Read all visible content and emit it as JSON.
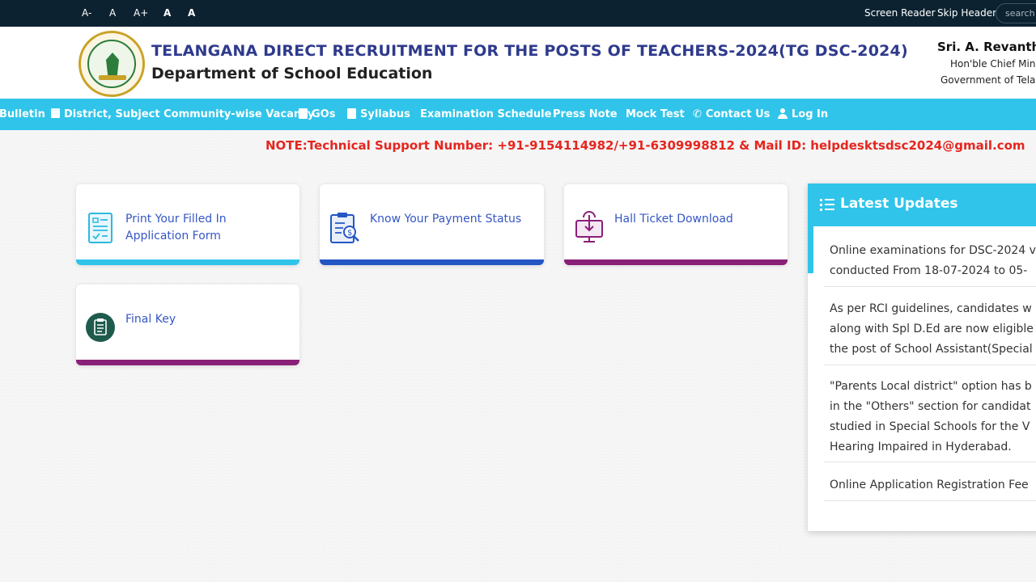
{
  "topbar": {
    "font_sizes": [
      "A-",
      "A",
      "A+",
      "A",
      "A"
    ],
    "screen_reader": "Screen Reader",
    "skip_header": "Skip Header",
    "search_placeholder": "search"
  },
  "header": {
    "title": "TELANGANA DIRECT RECRUITMENT FOR THE POSTS OF TEACHERS-2024(TG DSC-2024)",
    "subtitle": "Department of School Education",
    "cm_name": "Sri. A. Revanth R",
    "cm_role": "Hon'ble Chief Min",
    "cm_gov": "Government of Tela"
  },
  "nav": {
    "items": [
      {
        "label": "Bulletin",
        "icon": "none"
      },
      {
        "label": "District, Subject Community-wise Vacancy",
        "icon": "calendar-icon"
      },
      {
        "label": "GOs",
        "icon": "book-icon"
      },
      {
        "label": "Syllabus",
        "icon": "book-icon"
      },
      {
        "label": "Examination Schedule",
        "icon": "none"
      },
      {
        "label": "Press Note",
        "icon": "none"
      },
      {
        "label": "Mock Test",
        "icon": "none"
      },
      {
        "label": "Contact Us",
        "icon": "phone-icon"
      },
      {
        "label": "Log In",
        "icon": "user-icon"
      }
    ]
  },
  "note": "NOTE:Technical Support Number: +91-9154114982/+91-6309998812 & Mail ID: helpdesktsdsc2024@gmail.com",
  "cards": [
    {
      "line1": "Print Your Filled In",
      "line2": "Application Form",
      "icon": "form-icon",
      "bar_color": "#30c4ea"
    },
    {
      "line1": "Know Your Payment Status",
      "line2": "",
      "icon": "payment-status-icon",
      "bar_color": "#2456c4"
    },
    {
      "line1": "Hall Ticket Download",
      "line2": "",
      "icon": "download-icon",
      "bar_color": "#8a1f78"
    },
    {
      "line1": "Final Key",
      "line2": "",
      "icon": "clipboard-icon",
      "bar_color": "#8a1f78"
    }
  ],
  "updates": {
    "title": "Latest Updates",
    "items": [
      [
        "Online examinations for DSC-2024 v",
        "conducted From 18-07-2024 to 05-"
      ],
      [
        "As per RCI guidelines, candidates w",
        "along with Spl D.Ed are now eligible",
        "the post of School Assistant(Special"
      ],
      [
        "\"Parents Local district\" option has b",
        "in the \"Others\" section for candidat",
        "studied in Special Schools for the V",
        "Hearing Impaired in Hyderabad."
      ],
      [
        "Online Application Registration Fee"
      ]
    ]
  },
  "colors": {
    "topbar": "#0c2230",
    "nav": "#30c4ea",
    "note": "#e5261f",
    "title": "#2e3a8c",
    "card_text": "#3556c4"
  }
}
